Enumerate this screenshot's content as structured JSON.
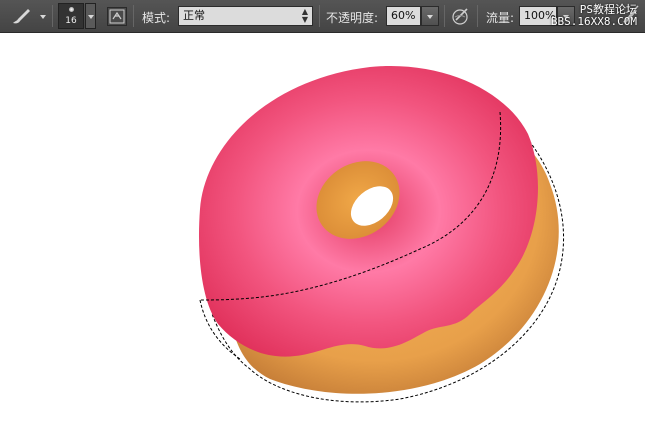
{
  "toolbar": {
    "tool_icon": "brush-icon",
    "brush_size": "16",
    "brush_panel_icon": "brush-panel-toggle-icon",
    "mode_label": "模式:",
    "mode_value": "正常",
    "opacity_label": "不透明度:",
    "opacity_value": "60%",
    "pressure_icon": "tablet-pressure-opacity-icon",
    "flow_label": "流量:",
    "flow_value": "100%",
    "airbrush_icon": "airbrush-icon"
  },
  "watermark": {
    "line1": "PS教程论坛",
    "line2": "BBS.16XX8.COM"
  },
  "canvas": {
    "subject": "donut-illustration",
    "colors": {
      "icing": "#f0507a",
      "icing_highlight": "#ff8fb0",
      "dough": "#e8a04a",
      "dough_dark": "#c07a30"
    }
  }
}
